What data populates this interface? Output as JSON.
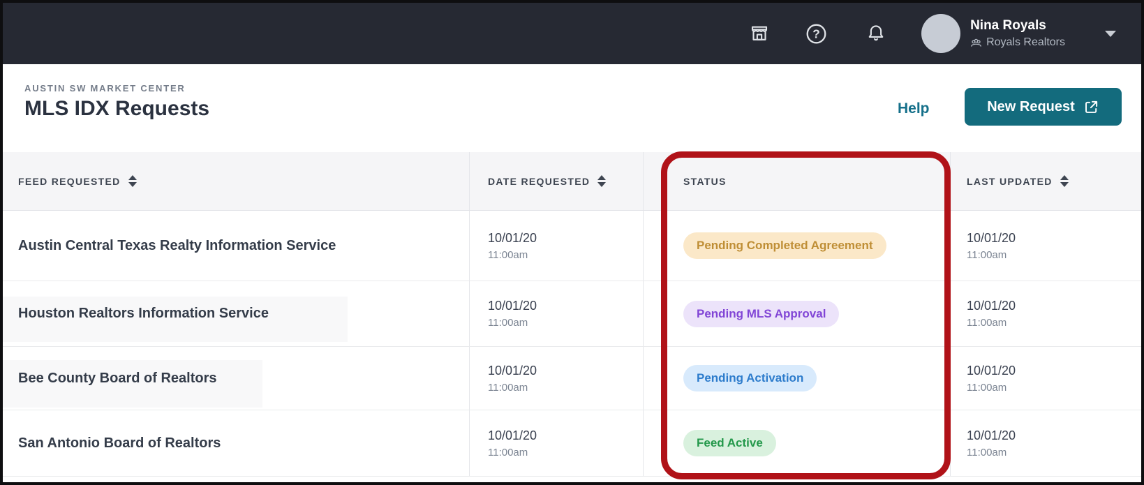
{
  "topbar": {
    "user_name": "Nina Royals",
    "user_org": "Royals Realtors"
  },
  "page_header": {
    "eyebrow": "AUSTIN SW MARKET CENTER",
    "title": "MLS IDX Requests",
    "help_label": "Help",
    "new_request_label": "New Request"
  },
  "table": {
    "columns": [
      {
        "label": "FEED REQUESTED",
        "sortable": true
      },
      {
        "label": "DATE REQUESTED",
        "sortable": true
      },
      {
        "label": "STATUS",
        "sortable": false
      },
      {
        "label": "LAST UPDATED",
        "sortable": true
      }
    ],
    "rows": [
      {
        "feed": "Austin Central Texas Realty Information Service",
        "date_requested": "10/01/20",
        "date_requested_time": "11:00am",
        "status": "Pending Completed Agreement",
        "status_variant": "amber",
        "last_updated": "10/01/20",
        "last_updated_time": "11:00am"
      },
      {
        "feed": "Houston Realtors Information Service",
        "date_requested": "10/01/20",
        "date_requested_time": "11:00am",
        "status": "Pending MLS Approval",
        "status_variant": "purple",
        "last_updated": "10/01/20",
        "last_updated_time": "11:00am"
      },
      {
        "feed": "Bee County Board of Realtors",
        "date_requested": "10/01/20",
        "date_requested_time": "11:00am",
        "status": "Pending Activation",
        "status_variant": "blue",
        "last_updated": "10/01/20",
        "last_updated_time": "11:00am"
      },
      {
        "feed": "San Antonio Board of Realtors",
        "date_requested": "10/01/20",
        "date_requested_time": "11:00am",
        "status": "Feed Active",
        "status_variant": "green",
        "last_updated": "10/01/20",
        "last_updated_time": "11:00am"
      }
    ]
  },
  "annotation": {
    "shape": "rounded-rectangle",
    "color": "#b01218",
    "highlights": "STATUS column"
  },
  "colors": {
    "topbar_bg": "#262933",
    "accent_teal": "#136b7d",
    "help_link": "#15708a",
    "badge_amber_bg": "#fbe8c8",
    "badge_amber_text": "#bf8e35",
    "badge_purple_bg": "#ece3fa",
    "badge_purple_text": "#8145d6",
    "badge_blue_bg": "#d8eafc",
    "badge_blue_text": "#2d7ccc",
    "badge_green_bg": "#d9f1de",
    "badge_green_text": "#23984a",
    "table_header_bg": "#f5f5f7"
  }
}
